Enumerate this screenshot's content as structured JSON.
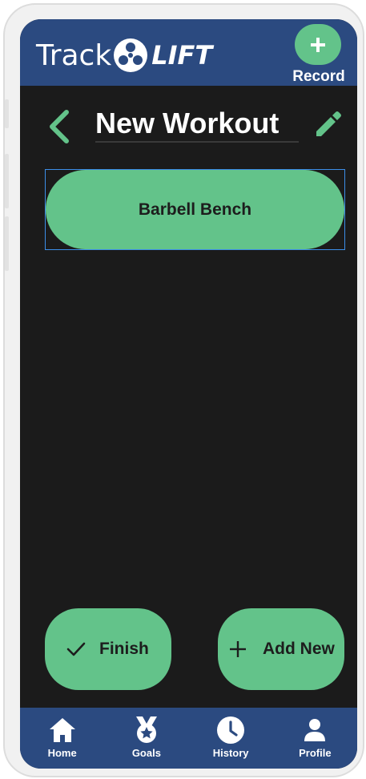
{
  "app": {
    "logo_track": "Track",
    "logo_lift": "LIFT",
    "logo_icon": "wheel-icon"
  },
  "header": {
    "record_label": "Record",
    "record_icon": "plus-icon"
  },
  "workout": {
    "title": "New Workout",
    "back_icon": "chevron-left-icon",
    "edit_icon": "pencil-icon"
  },
  "exercises": [
    {
      "name": "Barbell Bench"
    }
  ],
  "actions": {
    "finish_label": "Finish",
    "finish_icon": "check-icon",
    "add_label": "Add New",
    "add_icon": "plus-icon"
  },
  "nav": {
    "items": [
      {
        "label": "Home",
        "icon": "home-icon"
      },
      {
        "label": "Goals",
        "icon": "medal-icon"
      },
      {
        "label": "History",
        "icon": "clock-icon"
      },
      {
        "label": "Profile",
        "icon": "person-icon"
      }
    ]
  },
  "colors": {
    "header_bg": "#2b4a80",
    "accent_green": "#63c38a",
    "screen_bg": "#1b1b1b"
  }
}
